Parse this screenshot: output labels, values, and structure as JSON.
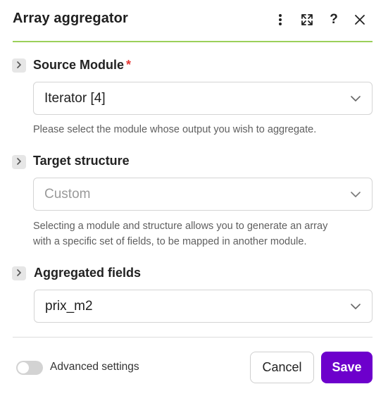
{
  "header": {
    "title": "Array aggregator",
    "icons": [
      "more-vertical-icon",
      "expand-icon",
      "help-icon",
      "close-icon"
    ]
  },
  "sections": {
    "source": {
      "label": "Source Module",
      "required_mark": "*",
      "value": "Iterator [4]",
      "help": "Please select the module whose output you wish to aggregate."
    },
    "target": {
      "label": "Target structure",
      "value": "Custom",
      "help_line1": "Selecting a module and structure allows you to generate an array",
      "help_line2": "with a specific set of fields, to be mapped in another module."
    },
    "aggregated": {
      "label": "Aggregated fields",
      "value": "prix_m2"
    }
  },
  "footer": {
    "advanced_label": "Advanced settings",
    "advanced_enabled": false,
    "cancel_label": "Cancel",
    "save_label": "Save"
  },
  "colors": {
    "accent": "#6d00cc",
    "header_border": "#9bd05a",
    "required": "#e53935"
  }
}
